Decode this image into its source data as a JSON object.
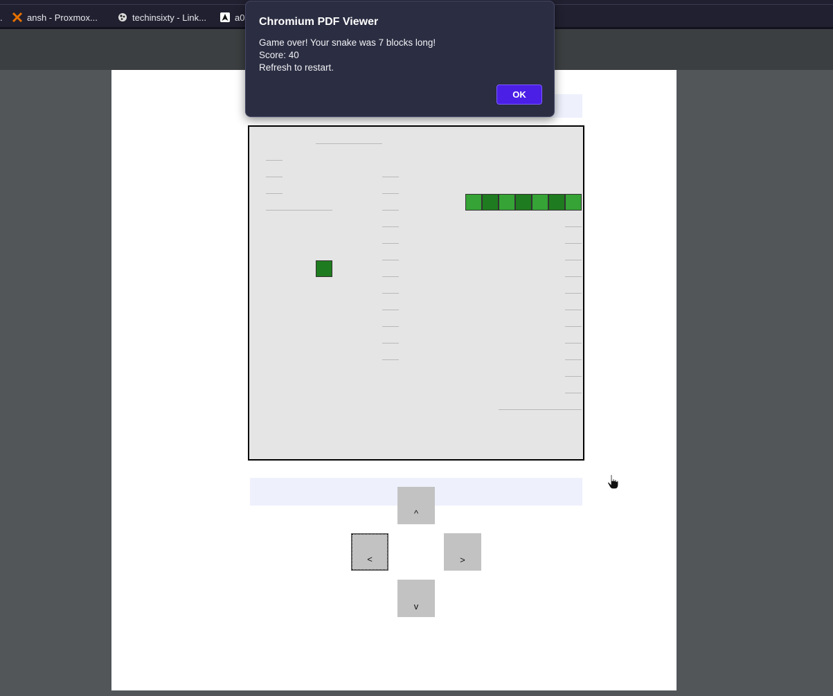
{
  "bookmarks": [
    {
      "label": "ansh - Proxmox...",
      "icon": "proxmox-icon"
    },
    {
      "label": "techinsixty - Link...",
      "icon": "gear-icon"
    },
    {
      "label": "a0",
      "icon": "arch-logo-icon"
    }
  ],
  "bookmark_prefix": ".",
  "dialog": {
    "title": "Chromium PDF Viewer",
    "message_line1": "Game over! Your snake was 7 blocks long!",
    "message_line2": "Score: 40",
    "message_line3": "Refresh to restart.",
    "ok_label": "OK"
  },
  "game": {
    "snake_length": 7,
    "score": 40
  },
  "controls": {
    "up_label": "^",
    "left_label": "<",
    "right_label": ">",
    "down_label": "v"
  },
  "colors": {
    "snake_dark": "#1f7b1f",
    "snake_light": "#35a335",
    "board_bg": "#e5e5e5",
    "ok_button": "#4b1fe6"
  }
}
